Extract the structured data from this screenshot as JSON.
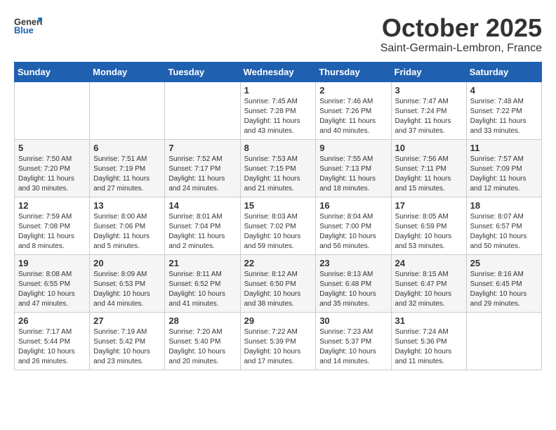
{
  "header": {
    "logo_general": "General",
    "logo_blue": "Blue",
    "month": "October 2025",
    "location": "Saint-Germain-Lembron, France"
  },
  "weekdays": [
    "Sunday",
    "Monday",
    "Tuesday",
    "Wednesday",
    "Thursday",
    "Friday",
    "Saturday"
  ],
  "weeks": [
    [
      {
        "day": "",
        "info": ""
      },
      {
        "day": "",
        "info": ""
      },
      {
        "day": "",
        "info": ""
      },
      {
        "day": "1",
        "info": "Sunrise: 7:45 AM\nSunset: 7:28 PM\nDaylight: 11 hours\nand 43 minutes."
      },
      {
        "day": "2",
        "info": "Sunrise: 7:46 AM\nSunset: 7:26 PM\nDaylight: 11 hours\nand 40 minutes."
      },
      {
        "day": "3",
        "info": "Sunrise: 7:47 AM\nSunset: 7:24 PM\nDaylight: 11 hours\nand 37 minutes."
      },
      {
        "day": "4",
        "info": "Sunrise: 7:48 AM\nSunset: 7:22 PM\nDaylight: 11 hours\nand 33 minutes."
      }
    ],
    [
      {
        "day": "5",
        "info": "Sunrise: 7:50 AM\nSunset: 7:20 PM\nDaylight: 11 hours\nand 30 minutes."
      },
      {
        "day": "6",
        "info": "Sunrise: 7:51 AM\nSunset: 7:19 PM\nDaylight: 11 hours\nand 27 minutes."
      },
      {
        "day": "7",
        "info": "Sunrise: 7:52 AM\nSunset: 7:17 PM\nDaylight: 11 hours\nand 24 minutes."
      },
      {
        "day": "8",
        "info": "Sunrise: 7:53 AM\nSunset: 7:15 PM\nDaylight: 11 hours\nand 21 minutes."
      },
      {
        "day": "9",
        "info": "Sunrise: 7:55 AM\nSunset: 7:13 PM\nDaylight: 11 hours\nand 18 minutes."
      },
      {
        "day": "10",
        "info": "Sunrise: 7:56 AM\nSunset: 7:11 PM\nDaylight: 11 hours\nand 15 minutes."
      },
      {
        "day": "11",
        "info": "Sunrise: 7:57 AM\nSunset: 7:09 PM\nDaylight: 11 hours\nand 12 minutes."
      }
    ],
    [
      {
        "day": "12",
        "info": "Sunrise: 7:59 AM\nSunset: 7:08 PM\nDaylight: 11 hours\nand 8 minutes."
      },
      {
        "day": "13",
        "info": "Sunrise: 8:00 AM\nSunset: 7:06 PM\nDaylight: 11 hours\nand 5 minutes."
      },
      {
        "day": "14",
        "info": "Sunrise: 8:01 AM\nSunset: 7:04 PM\nDaylight: 11 hours\nand 2 minutes."
      },
      {
        "day": "15",
        "info": "Sunrise: 8:03 AM\nSunset: 7:02 PM\nDaylight: 10 hours\nand 59 minutes."
      },
      {
        "day": "16",
        "info": "Sunrise: 8:04 AM\nSunset: 7:00 PM\nDaylight: 10 hours\nand 56 minutes."
      },
      {
        "day": "17",
        "info": "Sunrise: 8:05 AM\nSunset: 6:59 PM\nDaylight: 10 hours\nand 53 minutes."
      },
      {
        "day": "18",
        "info": "Sunrise: 8:07 AM\nSunset: 6:57 PM\nDaylight: 10 hours\nand 50 minutes."
      }
    ],
    [
      {
        "day": "19",
        "info": "Sunrise: 8:08 AM\nSunset: 6:55 PM\nDaylight: 10 hours\nand 47 minutes."
      },
      {
        "day": "20",
        "info": "Sunrise: 8:09 AM\nSunset: 6:53 PM\nDaylight: 10 hours\nand 44 minutes."
      },
      {
        "day": "21",
        "info": "Sunrise: 8:11 AM\nSunset: 6:52 PM\nDaylight: 10 hours\nand 41 minutes."
      },
      {
        "day": "22",
        "info": "Sunrise: 8:12 AM\nSunset: 6:50 PM\nDaylight: 10 hours\nand 38 minutes."
      },
      {
        "day": "23",
        "info": "Sunrise: 8:13 AM\nSunset: 6:48 PM\nDaylight: 10 hours\nand 35 minutes."
      },
      {
        "day": "24",
        "info": "Sunrise: 8:15 AM\nSunset: 6:47 PM\nDaylight: 10 hours\nand 32 minutes."
      },
      {
        "day": "25",
        "info": "Sunrise: 8:16 AM\nSunset: 6:45 PM\nDaylight: 10 hours\nand 29 minutes."
      }
    ],
    [
      {
        "day": "26",
        "info": "Sunrise: 7:17 AM\nSunset: 5:44 PM\nDaylight: 10 hours\nand 26 minutes."
      },
      {
        "day": "27",
        "info": "Sunrise: 7:19 AM\nSunset: 5:42 PM\nDaylight: 10 hours\nand 23 minutes."
      },
      {
        "day": "28",
        "info": "Sunrise: 7:20 AM\nSunset: 5:40 PM\nDaylight: 10 hours\nand 20 minutes."
      },
      {
        "day": "29",
        "info": "Sunrise: 7:22 AM\nSunset: 5:39 PM\nDaylight: 10 hours\nand 17 minutes."
      },
      {
        "day": "30",
        "info": "Sunrise: 7:23 AM\nSunset: 5:37 PM\nDaylight: 10 hours\nand 14 minutes."
      },
      {
        "day": "31",
        "info": "Sunrise: 7:24 AM\nSunset: 5:36 PM\nDaylight: 10 hours\nand 11 minutes."
      },
      {
        "day": "",
        "info": ""
      }
    ]
  ]
}
